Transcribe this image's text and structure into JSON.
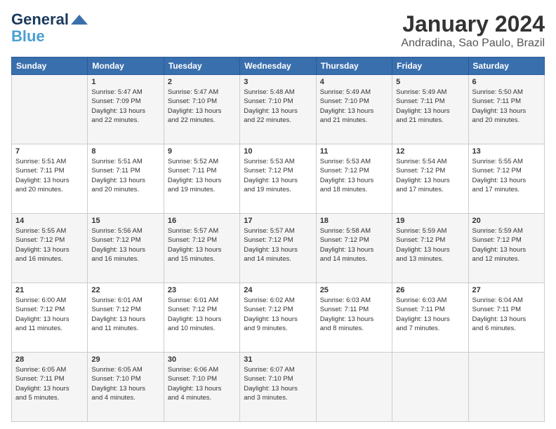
{
  "header": {
    "logo_line1": "General",
    "logo_line2": "Blue",
    "title": "January 2024",
    "subtitle": "Andradina, Sao Paulo, Brazil"
  },
  "columns": [
    "Sunday",
    "Monday",
    "Tuesday",
    "Wednesday",
    "Thursday",
    "Friday",
    "Saturday"
  ],
  "weeks": [
    [
      {
        "day": "",
        "info": ""
      },
      {
        "day": "1",
        "info": "Sunrise: 5:47 AM\nSunset: 7:09 PM\nDaylight: 13 hours\nand 22 minutes."
      },
      {
        "day": "2",
        "info": "Sunrise: 5:47 AM\nSunset: 7:10 PM\nDaylight: 13 hours\nand 22 minutes."
      },
      {
        "day": "3",
        "info": "Sunrise: 5:48 AM\nSunset: 7:10 PM\nDaylight: 13 hours\nand 22 minutes."
      },
      {
        "day": "4",
        "info": "Sunrise: 5:49 AM\nSunset: 7:10 PM\nDaylight: 13 hours\nand 21 minutes."
      },
      {
        "day": "5",
        "info": "Sunrise: 5:49 AM\nSunset: 7:11 PM\nDaylight: 13 hours\nand 21 minutes."
      },
      {
        "day": "6",
        "info": "Sunrise: 5:50 AM\nSunset: 7:11 PM\nDaylight: 13 hours\nand 20 minutes."
      }
    ],
    [
      {
        "day": "7",
        "info": "Sunrise: 5:51 AM\nSunset: 7:11 PM\nDaylight: 13 hours\nand 20 minutes."
      },
      {
        "day": "8",
        "info": "Sunrise: 5:51 AM\nSunset: 7:11 PM\nDaylight: 13 hours\nand 20 minutes."
      },
      {
        "day": "9",
        "info": "Sunrise: 5:52 AM\nSunset: 7:11 PM\nDaylight: 13 hours\nand 19 minutes."
      },
      {
        "day": "10",
        "info": "Sunrise: 5:53 AM\nSunset: 7:12 PM\nDaylight: 13 hours\nand 19 minutes."
      },
      {
        "day": "11",
        "info": "Sunrise: 5:53 AM\nSunset: 7:12 PM\nDaylight: 13 hours\nand 18 minutes."
      },
      {
        "day": "12",
        "info": "Sunrise: 5:54 AM\nSunset: 7:12 PM\nDaylight: 13 hours\nand 17 minutes."
      },
      {
        "day": "13",
        "info": "Sunrise: 5:55 AM\nSunset: 7:12 PM\nDaylight: 13 hours\nand 17 minutes."
      }
    ],
    [
      {
        "day": "14",
        "info": "Sunrise: 5:55 AM\nSunset: 7:12 PM\nDaylight: 13 hours\nand 16 minutes."
      },
      {
        "day": "15",
        "info": "Sunrise: 5:56 AM\nSunset: 7:12 PM\nDaylight: 13 hours\nand 16 minutes."
      },
      {
        "day": "16",
        "info": "Sunrise: 5:57 AM\nSunset: 7:12 PM\nDaylight: 13 hours\nand 15 minutes."
      },
      {
        "day": "17",
        "info": "Sunrise: 5:57 AM\nSunset: 7:12 PM\nDaylight: 13 hours\nand 14 minutes."
      },
      {
        "day": "18",
        "info": "Sunrise: 5:58 AM\nSunset: 7:12 PM\nDaylight: 13 hours\nand 14 minutes."
      },
      {
        "day": "19",
        "info": "Sunrise: 5:59 AM\nSunset: 7:12 PM\nDaylight: 13 hours\nand 13 minutes."
      },
      {
        "day": "20",
        "info": "Sunrise: 5:59 AM\nSunset: 7:12 PM\nDaylight: 13 hours\nand 12 minutes."
      }
    ],
    [
      {
        "day": "21",
        "info": "Sunrise: 6:00 AM\nSunset: 7:12 PM\nDaylight: 13 hours\nand 11 minutes."
      },
      {
        "day": "22",
        "info": "Sunrise: 6:01 AM\nSunset: 7:12 PM\nDaylight: 13 hours\nand 11 minutes."
      },
      {
        "day": "23",
        "info": "Sunrise: 6:01 AM\nSunset: 7:12 PM\nDaylight: 13 hours\nand 10 minutes."
      },
      {
        "day": "24",
        "info": "Sunrise: 6:02 AM\nSunset: 7:12 PM\nDaylight: 13 hours\nand 9 minutes."
      },
      {
        "day": "25",
        "info": "Sunrise: 6:03 AM\nSunset: 7:11 PM\nDaylight: 13 hours\nand 8 minutes."
      },
      {
        "day": "26",
        "info": "Sunrise: 6:03 AM\nSunset: 7:11 PM\nDaylight: 13 hours\nand 7 minutes."
      },
      {
        "day": "27",
        "info": "Sunrise: 6:04 AM\nSunset: 7:11 PM\nDaylight: 13 hours\nand 6 minutes."
      }
    ],
    [
      {
        "day": "28",
        "info": "Sunrise: 6:05 AM\nSunset: 7:11 PM\nDaylight: 13 hours\nand 5 minutes."
      },
      {
        "day": "29",
        "info": "Sunrise: 6:05 AM\nSunset: 7:10 PM\nDaylight: 13 hours\nand 4 minutes."
      },
      {
        "day": "30",
        "info": "Sunrise: 6:06 AM\nSunset: 7:10 PM\nDaylight: 13 hours\nand 4 minutes."
      },
      {
        "day": "31",
        "info": "Sunrise: 6:07 AM\nSunset: 7:10 PM\nDaylight: 13 hours\nand 3 minutes."
      },
      {
        "day": "",
        "info": ""
      },
      {
        "day": "",
        "info": ""
      },
      {
        "day": "",
        "info": ""
      }
    ]
  ]
}
